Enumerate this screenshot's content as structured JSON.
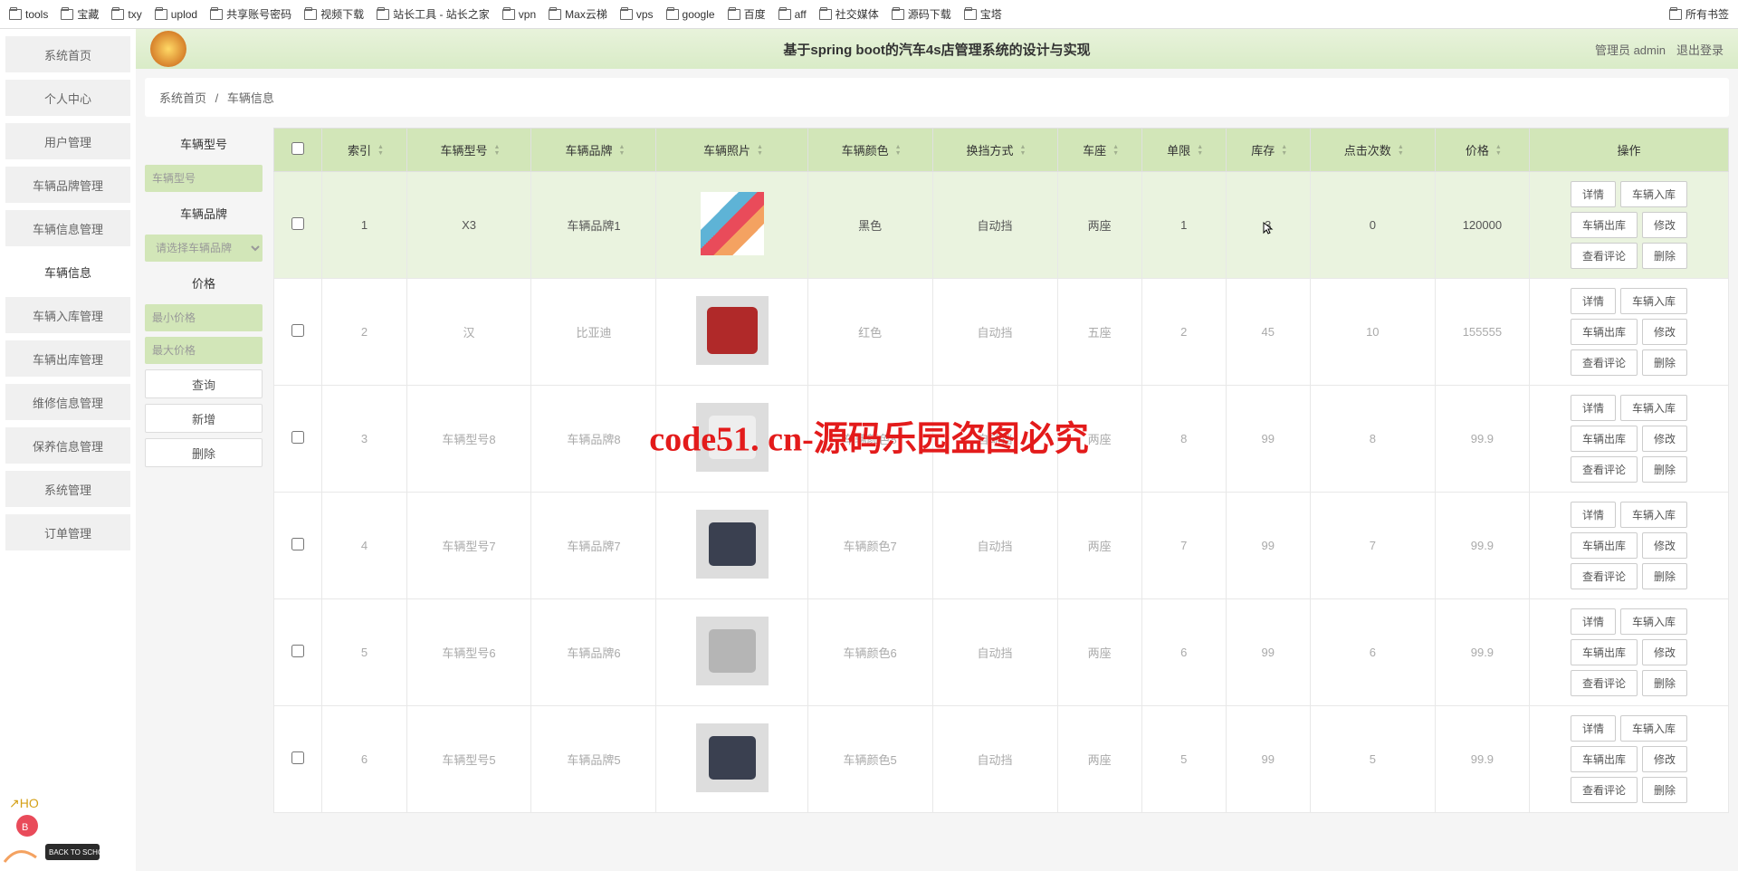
{
  "bookmarks": {
    "items": [
      "tools",
      "宝藏",
      "txy",
      "uplod",
      "共享账号密码",
      "视频下载",
      "站长工具 - 站长之家",
      "vpn",
      "Max云梯",
      "vps",
      "google",
      "百度",
      "aff",
      "社交媒体",
      "源码下载",
      "宝塔"
    ],
    "right": "所有书签"
  },
  "header": {
    "title": "基于spring boot的汽车4s店管理系统的设计与实现",
    "role": "管理员 admin",
    "logout": "退出登录"
  },
  "sidebar": {
    "items": [
      {
        "label": "系统首页"
      },
      {
        "label": "个人中心"
      },
      {
        "label": "用户管理"
      },
      {
        "label": "车辆品牌管理"
      },
      {
        "label": "车辆信息管理"
      },
      {
        "label": "车辆信息",
        "active": true
      },
      {
        "label": "车辆入库管理"
      },
      {
        "label": "车辆出库管理"
      },
      {
        "label": "维修信息管理"
      },
      {
        "label": "保养信息管理"
      },
      {
        "label": "系统管理"
      },
      {
        "label": "订单管理"
      }
    ]
  },
  "breadcrumb": {
    "home": "系统首页",
    "sep": "/",
    "current": "车辆信息"
  },
  "filter": {
    "model_label": "车辆型号",
    "model_ph": "车辆型号",
    "brand_label": "车辆品牌",
    "brand_ph": "请选择车辆品牌",
    "price_label": "价格",
    "min_ph": "最小价格",
    "max_ph": "最大价格",
    "search": "查询",
    "add": "新增",
    "delete": "删除"
  },
  "table": {
    "headers": [
      "",
      "索引",
      "车辆型号",
      "车辆品牌",
      "车辆照片",
      "车辆颜色",
      "换挡方式",
      "车座",
      "单限",
      "库存",
      "点击次数",
      "价格",
      "操作"
    ],
    "rows": [
      {
        "idx": "1",
        "model": "X3",
        "brand": "车辆品牌1",
        "img": "stripe",
        "color": "黑色",
        "shift": "自动挡",
        "seat": "两座",
        "limit": "1",
        "stock": "3",
        "clicks": "0",
        "price": "120000",
        "dim": false
      },
      {
        "idx": "2",
        "model": "汉",
        "brand": "比亚迪",
        "img": "red",
        "color": "红色",
        "shift": "自动挡",
        "seat": "五座",
        "limit": "2",
        "stock": "45",
        "clicks": "10",
        "price": "155555",
        "dim": true
      },
      {
        "idx": "3",
        "model": "车辆型号8",
        "brand": "车辆品牌8",
        "img": "white",
        "color": "车辆颜色8",
        "shift": "自动挡",
        "seat": "两座",
        "limit": "8",
        "stock": "99",
        "clicks": "8",
        "price": "99.9",
        "dim": true
      },
      {
        "idx": "4",
        "model": "车辆型号7",
        "brand": "车辆品牌7",
        "img": "dark",
        "color": "车辆颜色7",
        "shift": "自动挡",
        "seat": "两座",
        "limit": "7",
        "stock": "99",
        "clicks": "7",
        "price": "99.9",
        "dim": true
      },
      {
        "idx": "5",
        "model": "车辆型号6",
        "brand": "车辆品牌6",
        "img": "silver",
        "color": "车辆颜色6",
        "shift": "自动挡",
        "seat": "两座",
        "limit": "6",
        "stock": "99",
        "clicks": "6",
        "price": "99.9",
        "dim": true
      },
      {
        "idx": "6",
        "model": "车辆型号5",
        "brand": "车辆品牌5",
        "img": "dark",
        "color": "车辆颜色5",
        "shift": "自动挡",
        "seat": "两座",
        "limit": "5",
        "stock": "99",
        "clicks": "5",
        "price": "99.9",
        "dim": true
      }
    ],
    "actions": [
      "详情",
      "车辆入库",
      "车辆出库",
      "修改",
      "查看评论",
      "删除"
    ]
  },
  "watermark": "code51. cn-源码乐园盗图必究"
}
